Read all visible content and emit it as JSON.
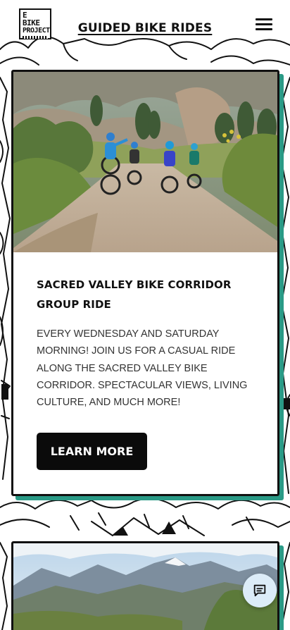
{
  "header": {
    "logo": {
      "line1": "E BIKE",
      "line2": "PROJECT",
      "line3": "CUSCO PERÚ"
    },
    "title": "GUIDED BIKE RIDES",
    "menu_icon": "hamburger-menu-icon"
  },
  "cards": [
    {
      "image_alt": "Group of cyclists riding e-bikes on a gravel road in the Sacred Valley",
      "title": "SACRED VALLEY BIKE CORRIDOR GROUP RIDE",
      "description": "EVERY WEDNESDAY AND SATURDAY MORNING! JOIN US FOR A CASUAL RIDE ALONG THE SACRED VALLEY BIKE CORRIDOR. SPECTACULAR VIEWS, LIVING CULTURE, AND MUCH MORE!",
      "button_label": "LEARN MORE"
    },
    {
      "image_alt": "Snow-capped Andes mountains above a green valley"
    }
  ],
  "chat": {
    "icon": "chat-bubble-icon"
  },
  "colors": {
    "accent_shadow": "#2a9a86",
    "button_bg": "#0b0b0b",
    "chat_bg": "#dcecf8"
  }
}
